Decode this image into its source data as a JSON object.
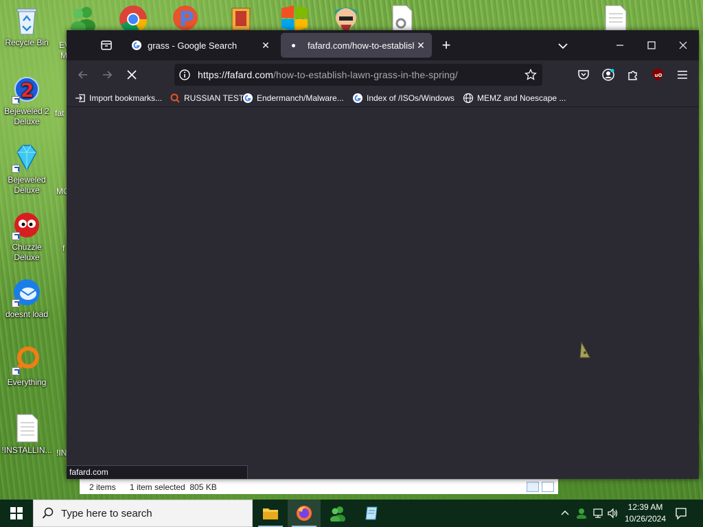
{
  "desktop": {
    "icons": [
      {
        "label": "Recycle Bin"
      },
      {
        "label": "Bejeweled 2 Deluxe"
      },
      {
        "label": "Bejeweled Deluxe"
      },
      {
        "label": "Chuzzle Deluxe"
      },
      {
        "label": "doesnt load"
      },
      {
        "label": "Everything"
      },
      {
        "label": "!INSTALLIN..."
      }
    ],
    "partial_labels": [
      "EV",
      "M",
      "fat",
      "MC",
      "f",
      "!IN"
    ]
  },
  "browser": {
    "tabs": [
      {
        "title": "grass - Google Search",
        "icon": "google-icon",
        "close": "✕"
      },
      {
        "title": "fafard.com/how-to-establish-la",
        "icon": "loading-dot",
        "close": "✕"
      }
    ],
    "new_tab_label": "+",
    "url": {
      "domain": "https://fafard.com",
      "path": "/how-to-establish-lawn-grass-in-the-spring/"
    },
    "bookmarks": [
      {
        "label": "Import bookmarks...",
        "icon": "import-icon"
      },
      {
        "label": "RUSSIAN TEST",
        "icon": "search-icon"
      },
      {
        "label": "Endermanch/Malware...",
        "icon": "google-icon"
      },
      {
        "label": "Index of /ISOs/Windows",
        "icon": "google-icon"
      },
      {
        "label": "MEMZ and Noescape ...",
        "icon": "globe-icon"
      }
    ],
    "status_link": "fafard.com",
    "colors": {
      "frame": "#1c1b22",
      "toolbar": "#2b2a33",
      "tab_active": "#42414d",
      "text": "#fbfbfe"
    }
  },
  "explorer_status": {
    "items": "2 items",
    "selected": "1 item selected  805 KB"
  },
  "taskbar": {
    "search_placeholder": "Type here to search",
    "time": "12:39 AM",
    "date": "10/26/2024"
  }
}
